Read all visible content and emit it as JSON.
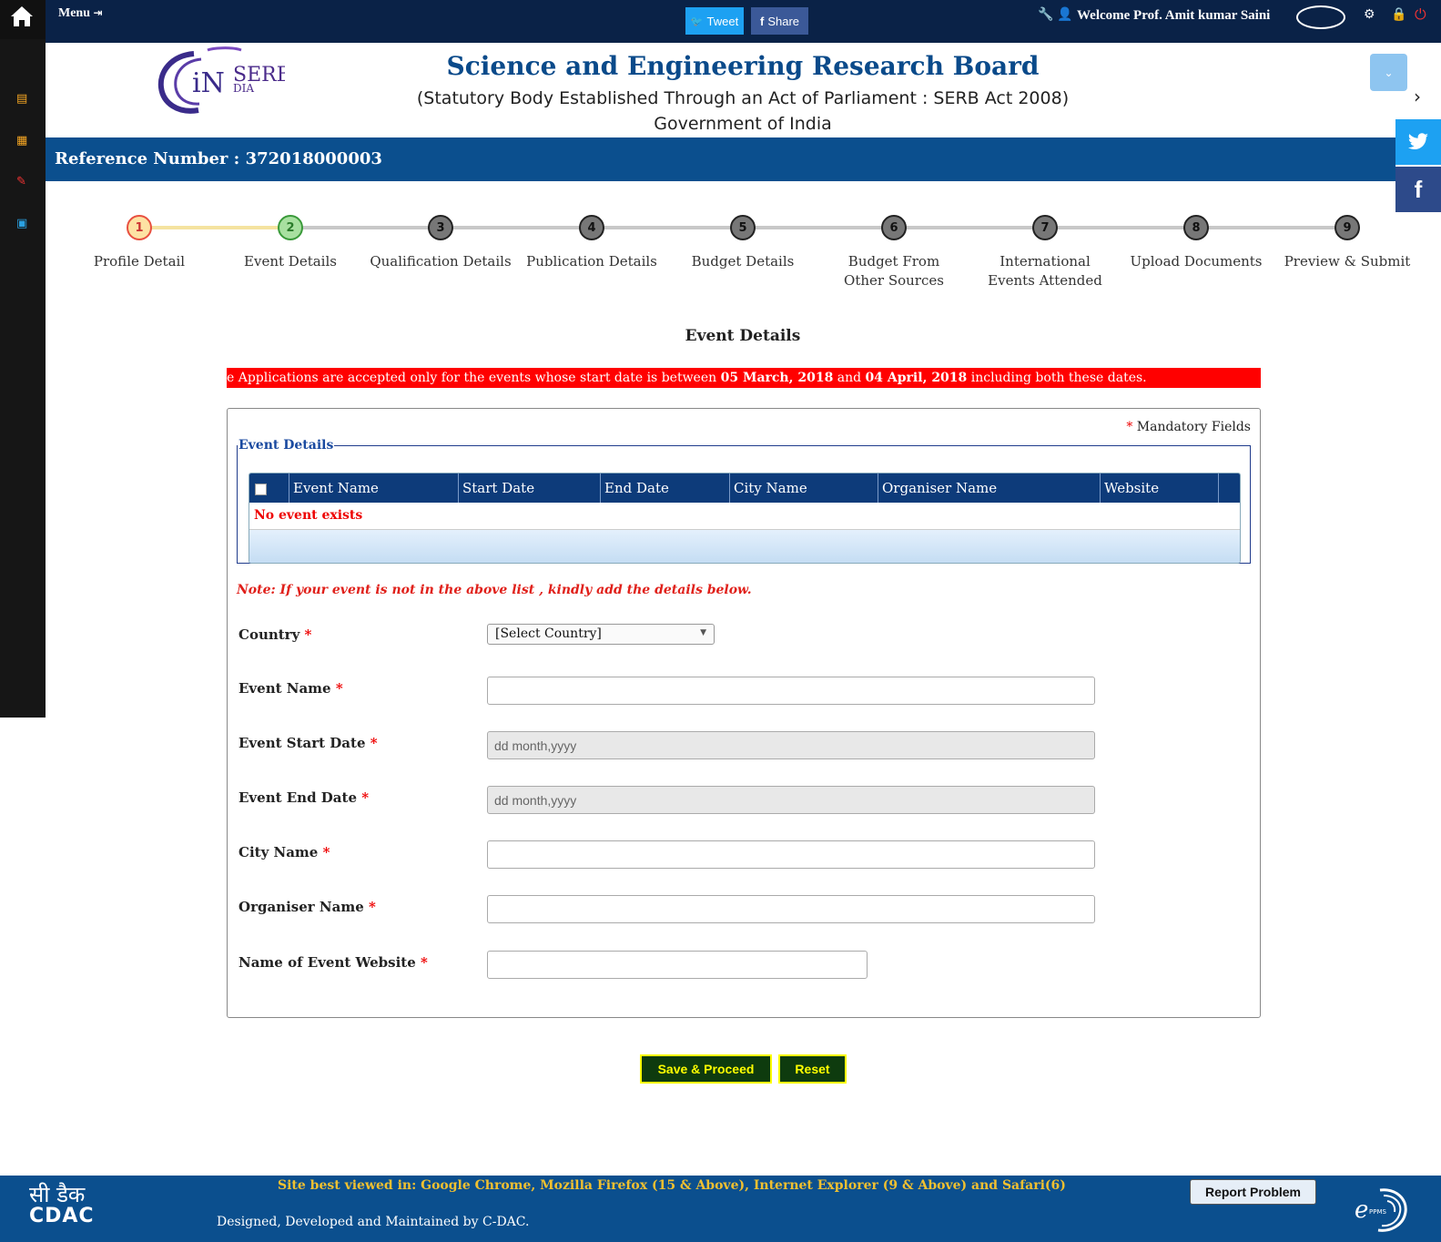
{
  "topbar": {
    "menu_label": "Menu",
    "tweet_label": "Tweet",
    "share_label": "Share",
    "welcome": "Welcome Prof. Amit kumar Saini"
  },
  "header": {
    "logo_text_1": "SERB",
    "logo_text_2": "DIA",
    "logo_text_3": "iN",
    "title": "Science and Engineering Research Board",
    "subtitle": "(Statutory Body Established Through an Act of Parliament : SERB Act 2008)",
    "gov": "Government of India"
  },
  "reference": {
    "label": "Reference Number : 372018000003"
  },
  "steps": [
    {
      "num": "1",
      "label": "Profile Detail"
    },
    {
      "num": "2",
      "label": "Event Details"
    },
    {
      "num": "3",
      "label": "Qualification Details"
    },
    {
      "num": "4",
      "label": "Publication Details"
    },
    {
      "num": "5",
      "label": "Budget Details"
    },
    {
      "num": "6",
      "label": "Budget From Other Sources"
    },
    {
      "num": "7",
      "label": "International Events Attended"
    },
    {
      "num": "8",
      "label": "Upload Documents"
    },
    {
      "num": "9",
      "label": "Preview & Submit"
    }
  ],
  "section_title": "Event Details",
  "marquee": {
    "part1": "e Applications are accepted only for the events whose start date is between ",
    "date1": "05 March, 2018",
    "part2": " and ",
    "date2": "04 April, 2018",
    "part3": " including both these dates."
  },
  "form": {
    "mandatory_star": "*",
    "mandatory_label": " Mandatory Fields",
    "fieldset_legend": "Event Details",
    "grid_columns": [
      "Event Name",
      "Start Date",
      "End Date",
      "City Name",
      "Organiser Name",
      "Website"
    ],
    "grid_empty": "No event exists",
    "note": "Note: If your event is not in the above list , kindly add the details below.",
    "country_label": "Country",
    "country_value": "[Select Country]",
    "event_name_label": "Event Name",
    "start_date_label": "Event Start Date",
    "start_date_placeholder": "dd month,yyyy",
    "end_date_label": "Event End Date",
    "end_date_placeholder": "dd month,yyyy",
    "city_label": "City Name",
    "organiser_label": "Organiser Name",
    "website_label": "Name of Event Website",
    "required_mark": "*"
  },
  "buttons": {
    "save": "Save & Proceed",
    "reset": "Reset"
  },
  "footer": {
    "cdac_hindi": "सी डैक",
    "cdac_english": "CDAC",
    "best_viewed": "Site best viewed in: Google Chrome, Mozilla Firefox (15 & Above), Internet Explorer (9 & Above) and Safari(6)",
    "designed": "Designed, Developed and Maintained by C-DAC.",
    "report": "Report Problem",
    "eppms_e": "e",
    "eppms_text": "PPMS"
  },
  "colors": {
    "topbar": "#0a2247",
    "accent_blue": "#0b4f8e",
    "marquee_red": "#ff0000",
    "button_bg": "#0e3b0e",
    "button_text": "#ffff00"
  },
  "icons": [
    "home-icon",
    "sign-in-icon",
    "twitter-icon",
    "facebook-icon",
    "wrench-icon",
    "user-icon",
    "settings-icon",
    "lock-icon",
    "power-icon",
    "file-icon",
    "calculator-icon",
    "edit-icon",
    "image-icon",
    "chevron-down-icon",
    "chevron-right-icon"
  ]
}
